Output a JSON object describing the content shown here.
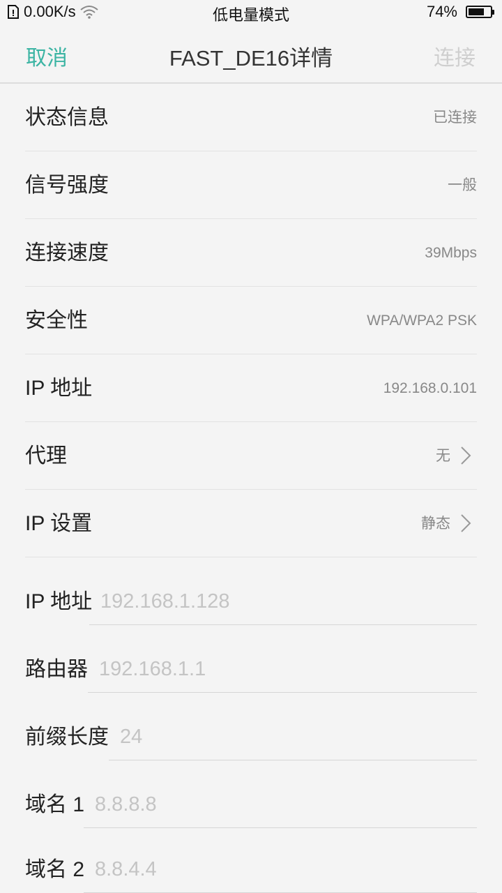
{
  "status_bar": {
    "network_speed": "0.00K/s",
    "mode": "低电量模式",
    "battery_percent": "74%",
    "battery_level": 0.74,
    "icons": [
      "sim-card-icon",
      "wifi-icon",
      "battery-icon"
    ]
  },
  "nav": {
    "cancel_label": "取消",
    "title": "FAST_DE16详情",
    "connect_label": "连接"
  },
  "info_rows": [
    {
      "label": "状态信息",
      "value": "已连接"
    },
    {
      "label": "信号强度",
      "value": "一般"
    },
    {
      "label": "连接速度",
      "value": "39Mbps"
    },
    {
      "label": "安全性",
      "value": "WPA/WPA2 PSK"
    },
    {
      "label": "IP 地址",
      "value": "192.168.0.101"
    },
    {
      "label": "代理",
      "value": "无"
    },
    {
      "label": "IP 设置",
      "value": "静态"
    }
  ],
  "static_fields": [
    {
      "label": "IP 地址",
      "placeholder": "192.168.1.128"
    },
    {
      "label": "路由器",
      "placeholder": "192.168.1.1"
    },
    {
      "label": "前缀长度",
      "placeholder": "24"
    },
    {
      "label": "域名 1",
      "placeholder": "8.8.8.8"
    },
    {
      "label": "域名 2",
      "placeholder": "8.8.4.4"
    }
  ],
  "colors": {
    "accent": "#3bb4a3",
    "disabled": "#cfcfcf",
    "background": "#f4f4f4"
  }
}
